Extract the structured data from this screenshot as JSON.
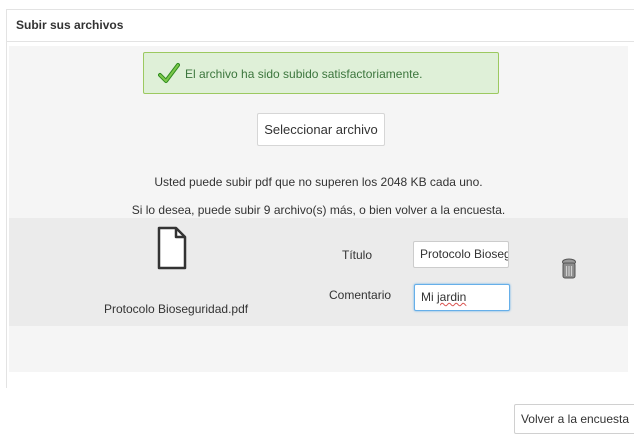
{
  "panel": {
    "title": "Subir sus archivos"
  },
  "alert": {
    "message": "El archivo ha sido subido satisfactoriamente.",
    "icon": "checkmark-icon",
    "background": "#dff0d8",
    "border": "#9cc960"
  },
  "upload": {
    "select_label": "Seleccionar archivo",
    "limit_text": "Usted puede subir pdf que no superen los 2048 KB cada uno.",
    "remaining_text": "Si lo desea, puede subir 9 archivo(s) más, o bien volver a la encuesta."
  },
  "file": {
    "icon": "document-icon",
    "name": "Protocolo Bioseguridad.pdf",
    "title_label": "Título",
    "title_value": "Protocolo Bioseg",
    "comment_label": "Comentario",
    "comment_prefix": "Mi ",
    "comment_misspelled": "jardin",
    "delete_icon": "trash-icon"
  },
  "footer": {
    "back_label": "Volver a la encuesta"
  }
}
